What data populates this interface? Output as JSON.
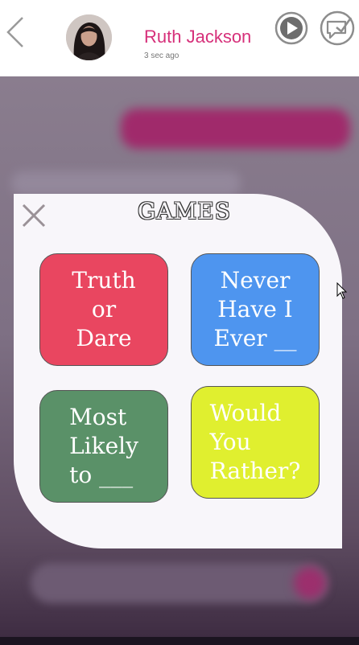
{
  "header": {
    "contact_name": "Ruth Jackson",
    "last_seen": "3 sec ago",
    "back_icon": "chevron-left-icon",
    "play_icon": "play-icon",
    "message_icon": "message-check-icon"
  },
  "modal": {
    "title": "GAMES",
    "close_icon": "close-icon",
    "games": [
      {
        "label": "Truth\nor\nDare",
        "color": "#e94660"
      },
      {
        "label": "Never\nHave I\nEver __",
        "color": "#4e95ef"
      },
      {
        "label": "Most\nLikely\nto ___",
        "color": "#5a9168"
      },
      {
        "label": "Would\nYou\nRather?",
        "color": "#e0ef2f"
      }
    ]
  },
  "colors": {
    "accent": "#d6307a",
    "modal_bg": "#f8f6fa"
  }
}
